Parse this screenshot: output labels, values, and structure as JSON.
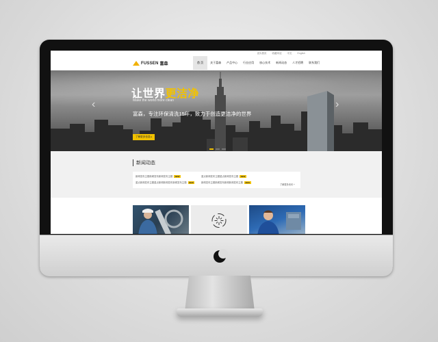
{
  "topbar": {
    "links": [
      "设为首页",
      "收藏本站",
      "中文",
      "English"
    ]
  },
  "logo": {
    "brand_en": "FUSSEN",
    "brand_cn": "富森"
  },
  "nav": {
    "items": [
      "首 页",
      "关于富森",
      "产品中心",
      "行业应用",
      "核心技术",
      "新闻动态",
      "人才招聘",
      "联系我们"
    ],
    "active_index": 0
  },
  "hero": {
    "title_plain": "让世界",
    "title_highlight": "更洁净",
    "subtitle_en": "Make the world more clean",
    "slogan": "富森，专注环保清洗15年，致力于创造更洁净的世界",
    "button": "了解更多信息 ▸",
    "arrow_left": "‹",
    "arrow_right": "›",
    "slide_count": 3,
    "active_slide": 0
  },
  "news": {
    "title": "新闻动态",
    "items": [
      {
        "text": "新闻发布主题新闻发布新闻发布主题",
        "badge": "NEW"
      },
      {
        "text": "重点新闻发布主题重点新闻发布主题",
        "badge": "NEW"
      },
      {
        "text": "重点新闻发布主题重点新闻新闻发布新闻发布主题",
        "badge": "NEW"
      },
      {
        "text": "新闻发布主题新闻发布新闻新闻发布主题",
        "badge": "NEW"
      }
    ],
    "more": "了解更多资讯 +"
  },
  "colors": {
    "accent": "#f2c200",
    "nav_active_bg": "#e5e5e5",
    "news_bg": "#f1f1f1"
  },
  "icons": {
    "tile_2": "sparkle-cycle-icon"
  }
}
